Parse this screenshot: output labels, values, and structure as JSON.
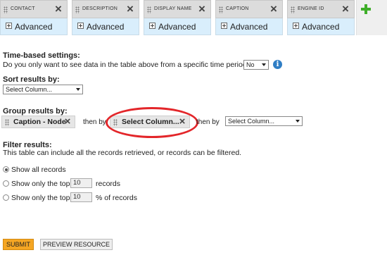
{
  "columns": [
    {
      "title": "CONTACT",
      "advanced": "Advanced"
    },
    {
      "title": "DESCRIPTION",
      "advanced": "Advanced"
    },
    {
      "title": "DISPLAY NAME",
      "advanced": "Advanced"
    },
    {
      "title": "CAPTION",
      "advanced": "Advanced"
    },
    {
      "title": "ENGINE ID",
      "advanced": "Advanced"
    }
  ],
  "time_settings": {
    "heading": "Time-based settings:",
    "question": "Do you only want to see data in the table above from a specific time period?",
    "value": "No"
  },
  "sort": {
    "heading": "Sort results by:",
    "value": "Select Column..."
  },
  "group": {
    "heading": "Group results by:",
    "chip1": "Caption - Node",
    "then_by_1": "then by",
    "chip2": "Select Column...",
    "then_by_2": "then by",
    "select_value": "Select Column..."
  },
  "filter": {
    "heading": "Filter results:",
    "description": "This table can include all the records retrieved, or records can be filtered.",
    "option_all": "Show all records",
    "option_top_prefix": "Show only the top",
    "top_records_value": "10",
    "option_top_suffix": "records",
    "option_pct_prefix": "Show only the top",
    "top_pct_value": "10",
    "option_pct_suffix": "% of records"
  },
  "buttons": {
    "submit": "SUBMIT",
    "preview": "PREVIEW RESOURCE"
  },
  "icons": {
    "remove": "×",
    "info": "i"
  },
  "colors": {
    "accent_green": "#3fae2a",
    "submit_orange": "#f5a623",
    "highlight_red": "#e3262a",
    "info_blue": "#2f7ec5"
  }
}
